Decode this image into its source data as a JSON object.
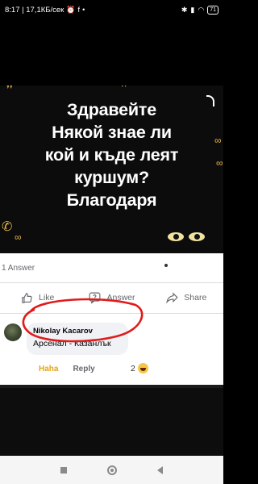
{
  "status_bar": {
    "time_speed": "8:17 | 17,1КБ/сек",
    "battery": "71"
  },
  "post": {
    "headline_lines": [
      "Здравейте",
      "Някой знае ли",
      "кой и къде леят",
      "куршум?",
      "Благодаря"
    ]
  },
  "answers": {
    "count_label": "1 Answer"
  },
  "actions": {
    "like": "Like",
    "answer": "Answer",
    "share": "Share"
  },
  "comment": {
    "author": "Nikolay Kacarov",
    "text": "Арсенал - Казанлък",
    "reaction_label": "Haha",
    "reply_label": "Reply",
    "reaction_count": "2"
  },
  "colors": {
    "haha": "#e4a516",
    "highlight_circle": "#e01b1b"
  }
}
